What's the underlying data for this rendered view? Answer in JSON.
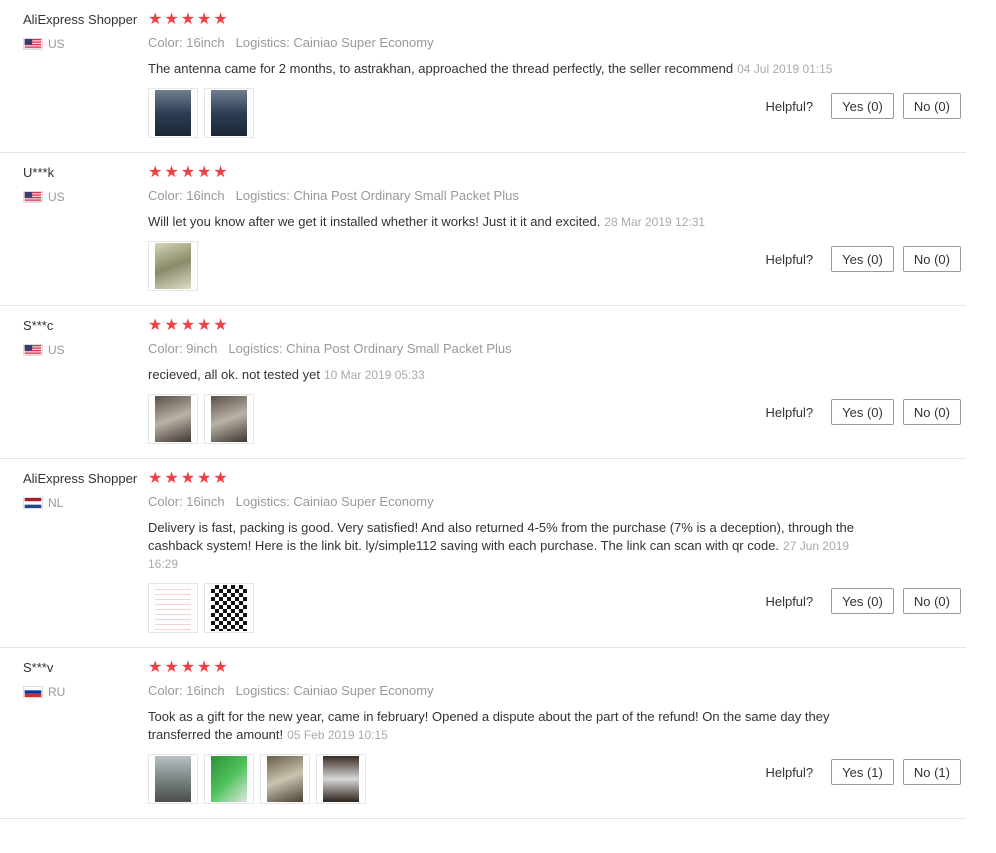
{
  "helpful_label": "Helpful?",
  "colors": {
    "star": "#f04046",
    "meta": "#999999",
    "border": "#e6e6e6"
  },
  "reviews": [
    {
      "user": "AliExpress Shopper",
      "country": "US",
      "flag_icon": "us-flag-icon",
      "stars": 5,
      "color": "Color: 16inch",
      "logistics": "Logistics: Cainiao Super Economy",
      "text": "The antenna came for 2 months, to astrakhan, approached the thread perfectly, the seller recommend",
      "date": "04 Jul 2019 01:15",
      "yes": "Yes (0)",
      "no": "No (0)",
      "photos": [
        "photo-car-antenna-icon",
        "photo-car-antenna-icon"
      ]
    },
    {
      "user": "U***k",
      "country": "US",
      "flag_icon": "us-flag-icon",
      "stars": 5,
      "color": "Color: 16inch",
      "logistics": "Logistics: China Post Ordinary Small Packet Plus",
      "text": "Will let you know after we get it installed whether it works! Just it it and excited.",
      "date": "28 Mar 2019 12:31",
      "yes": "Yes (0)",
      "no": "No (0)",
      "photos": [
        "photo-antenna-rod-icon"
      ]
    },
    {
      "user": "S***c",
      "country": "US",
      "flag_icon": "us-flag-icon",
      "stars": 5,
      "color": "Color: 9inch",
      "logistics": "Logistics: China Post Ordinary Small Packet Plus",
      "text": "recieved, all ok. not tested yet",
      "date": "10 Mar 2019 05:33",
      "yes": "Yes (0)",
      "no": "No (0)",
      "photos": [
        "photo-package-hand-icon",
        "photo-package-hand-icon"
      ]
    },
    {
      "user": "AliExpress Shopper",
      "country": "NL",
      "flag_icon": "nl-flag-icon",
      "stars": 5,
      "color": "Color: 16inch",
      "logistics": "Logistics: Cainiao Super Economy",
      "text": "Delivery is fast, packing is good. Very satisfied! And also returned 4-5% from the purchase (7% is a deception), through the cashback system! Here is the link bit. ly/simple112 saving with each purchase. The link can scan with qr code.",
      "date": "27 Jun 2019 16:29",
      "yes": "Yes (0)",
      "no": "No (0)",
      "photos": [
        "photo-screenshot-list-icon",
        "photo-qr-code-icon"
      ]
    },
    {
      "user": "S***v",
      "country": "RU",
      "flag_icon": "ru-flag-icon",
      "stars": 5,
      "color": "Color: 16inch",
      "logistics": "Logistics: Cainiao Super Economy",
      "text": "Took as a gift for the new year, came in february! Opened a dispute about the part of the refund! On the same day they transferred the amount!",
      "date": "05 Feb 2019 10:15",
      "yes": "Yes (1)",
      "no": "No (1)",
      "photos": [
        "photo-car-window-icon",
        "photo-green-antenna-icon",
        "photo-antenna-hand-icon",
        "photo-antenna-box-icon"
      ]
    }
  ]
}
